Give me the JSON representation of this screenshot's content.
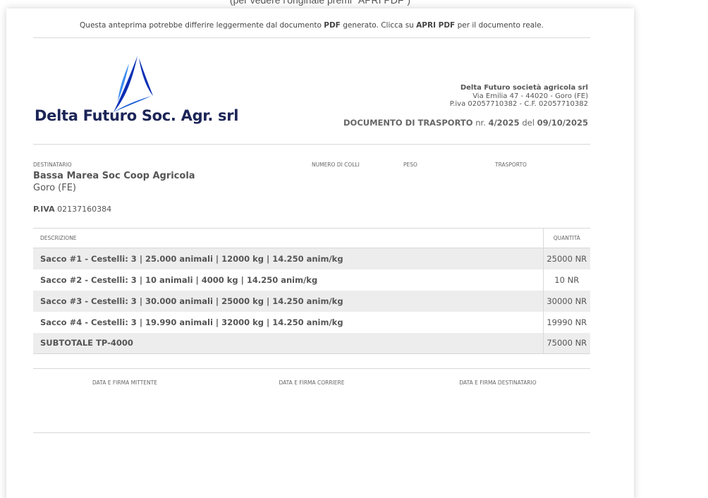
{
  "top_hint": "(per vedere l'originale premi \"APRI PDF\")",
  "notice": {
    "part1": "Questa anteprima potrebbe differire leggermente dal documento ",
    "pdf1": "PDF",
    "part2": " generato. Clicca su ",
    "apri": "APRI PDF",
    "part3": " per il documento reale."
  },
  "logo": {
    "text": "Delta Futuro Soc. Agr. srl",
    "colors": {
      "sail_dark": "#0a2fb5",
      "sail_light": "#3d8ef0",
      "text": "#1c2557"
    }
  },
  "company": {
    "name": "Delta Futuro società agricola srl",
    "address": "Via Emilia 47 - 44020 - Goro (FE)",
    "tax": "P.iva 02057710382 - C.F. 02057710382"
  },
  "doc": {
    "label": "DOCUMENTO DI TRASPORTO",
    "nr_label": "nr.",
    "number": "4/2025",
    "del_label": "del",
    "date": "09/10/2025"
  },
  "labels": {
    "destinatario": "DESTINATARIO",
    "numero_colli": "NUMERO DI COLLI",
    "peso": "PESO",
    "trasporto": "TRASPORTO"
  },
  "recipient": {
    "name": "Bassa Marea Soc Coop Agricola",
    "city": "Goro (FE)",
    "piva_label": "P.IVA",
    "piva": "02137160384"
  },
  "table": {
    "headers": {
      "descrizione": "DESCRIZIONE",
      "quantita": "QUANTITÀ"
    },
    "rows": [
      {
        "desc": "Sacco #1 - Cestelli: 3 | 25.000 animali | 12000 kg | 14.250 anim/kg",
        "qty": "25000 NR"
      },
      {
        "desc": "Sacco #2 - Cestelli: 3 | 10 animali | 4000 kg | 14.250 anim/kg",
        "qty": "10 NR"
      },
      {
        "desc": "Sacco #3 - Cestelli: 3 | 30.000 animali | 25000 kg | 14.250 anim/kg",
        "qty": "30000 NR"
      },
      {
        "desc": "Sacco #4 - Cestelli: 3 | 19.990 animali | 32000 kg | 14.250 anim/kg",
        "qty": "19990 NR"
      },
      {
        "desc": "SUBTOTALE TP-4000",
        "qty": "75000 NR"
      }
    ]
  },
  "signatures": {
    "mittente": "DATA E FIRMA MITTENTE",
    "corriere": "DATA E FIRMA CORRIERE",
    "destinatario": "DATA E FIRMA DESTINATARIO"
  }
}
